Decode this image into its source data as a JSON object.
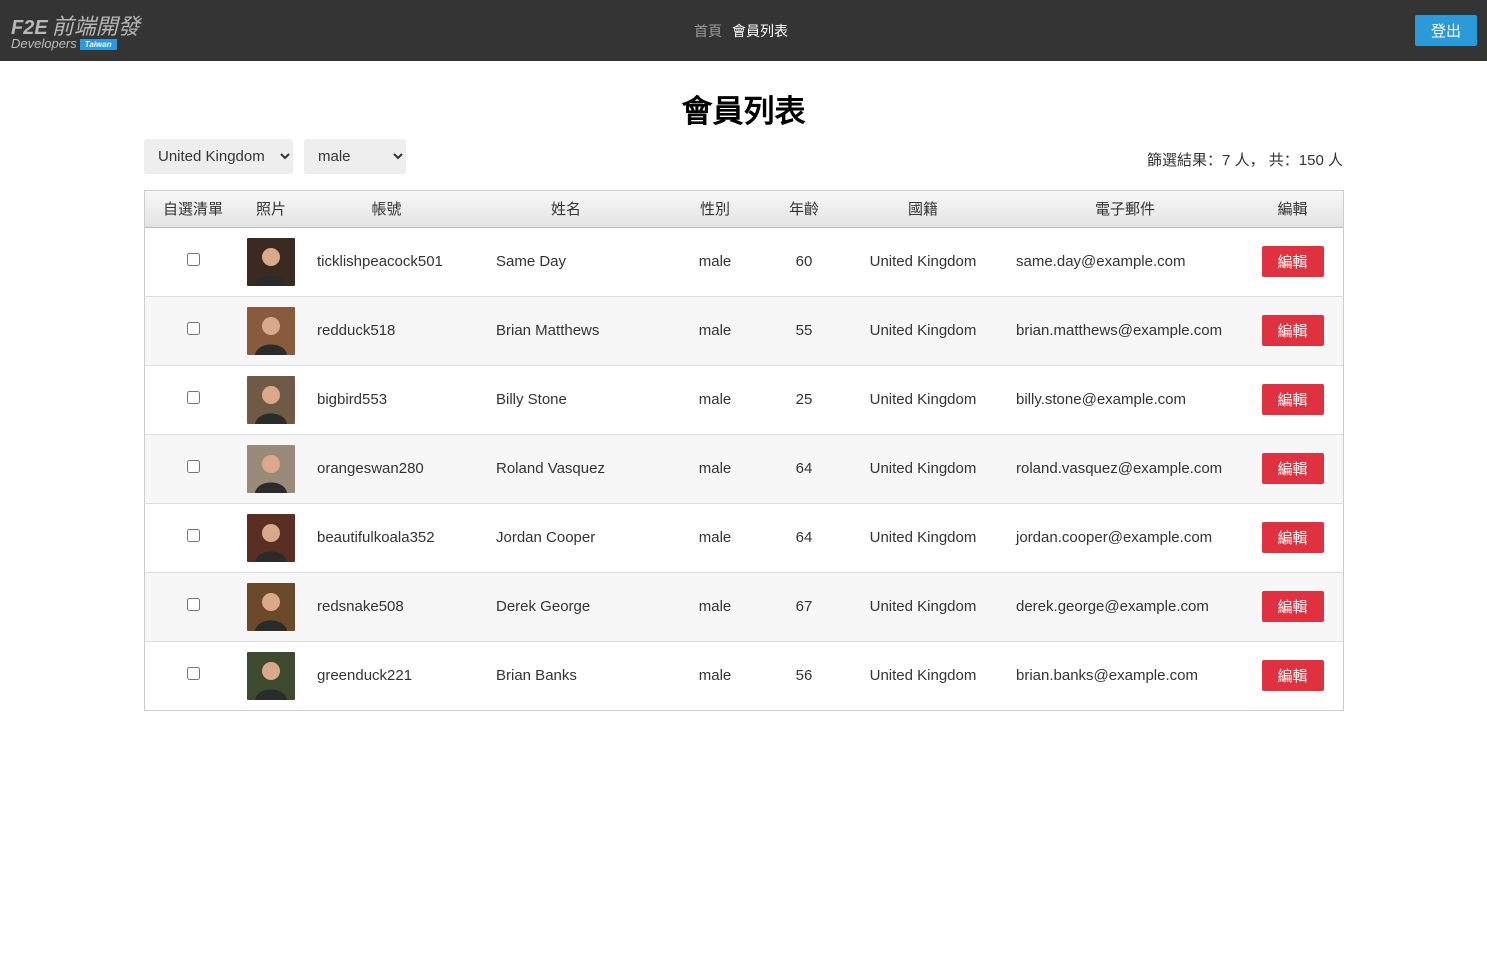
{
  "header": {
    "logo": {
      "brand": "F2E",
      "cjk": "前端開發",
      "sub": "Developers",
      "badge": "Taiwan"
    },
    "nav": [
      {
        "label": "首頁",
        "active": false
      },
      {
        "label": "會員列表",
        "active": true
      }
    ],
    "logout_label": "登出"
  },
  "page_title": "會員列表",
  "filters": {
    "country": {
      "selected": "United Kingdom"
    },
    "gender": {
      "selected": "male"
    }
  },
  "summary": {
    "filtered_label": "篩選結果：",
    "filtered_count": "7",
    "filtered_unit": "人",
    "sep": "，",
    "total_label": "共：",
    "total_count": "150",
    "total_unit": "人"
  },
  "table": {
    "columns": [
      "自選清單",
      "照片",
      "帳號",
      "姓名",
      "性別",
      "年齡",
      "國籍",
      "電子郵件",
      "編輯"
    ],
    "edit_label": "編輯",
    "rows": [
      {
        "username": "ticklishpeacock501",
        "name": "Same Day",
        "gender": "male",
        "age": "60",
        "country": "United Kingdom",
        "email": "same.day@example.com",
        "avatar_color": "#3b2a22"
      },
      {
        "username": "redduck518",
        "name": "Brian Matthews",
        "gender": "male",
        "age": "55",
        "country": "United Kingdom",
        "email": "brian.matthews@example.com",
        "avatar_color": "#8a5a3c"
      },
      {
        "username": "bigbird553",
        "name": "Billy Stone",
        "gender": "male",
        "age": "25",
        "country": "United Kingdom",
        "email": "billy.stone@example.com",
        "avatar_color": "#6f5a48"
      },
      {
        "username": "orangeswan280",
        "name": "Roland Vasquez",
        "gender": "male",
        "age": "64",
        "country": "United Kingdom",
        "email": "roland.vasquez@example.com",
        "avatar_color": "#9a8a7a"
      },
      {
        "username": "beautifulkoala352",
        "name": "Jordan Cooper",
        "gender": "male",
        "age": "64",
        "country": "United Kingdom",
        "email": "jordan.cooper@example.com",
        "avatar_color": "#5a2e22"
      },
      {
        "username": "redsnake508",
        "name": "Derek George",
        "gender": "male",
        "age": "67",
        "country": "United Kingdom",
        "email": "derek.george@example.com",
        "avatar_color": "#6b4a2a"
      },
      {
        "username": "greenduck221",
        "name": "Brian Banks",
        "gender": "male",
        "age": "56",
        "country": "United Kingdom",
        "email": "brian.banks@example.com",
        "avatar_color": "#3d4a2e"
      }
    ]
  }
}
